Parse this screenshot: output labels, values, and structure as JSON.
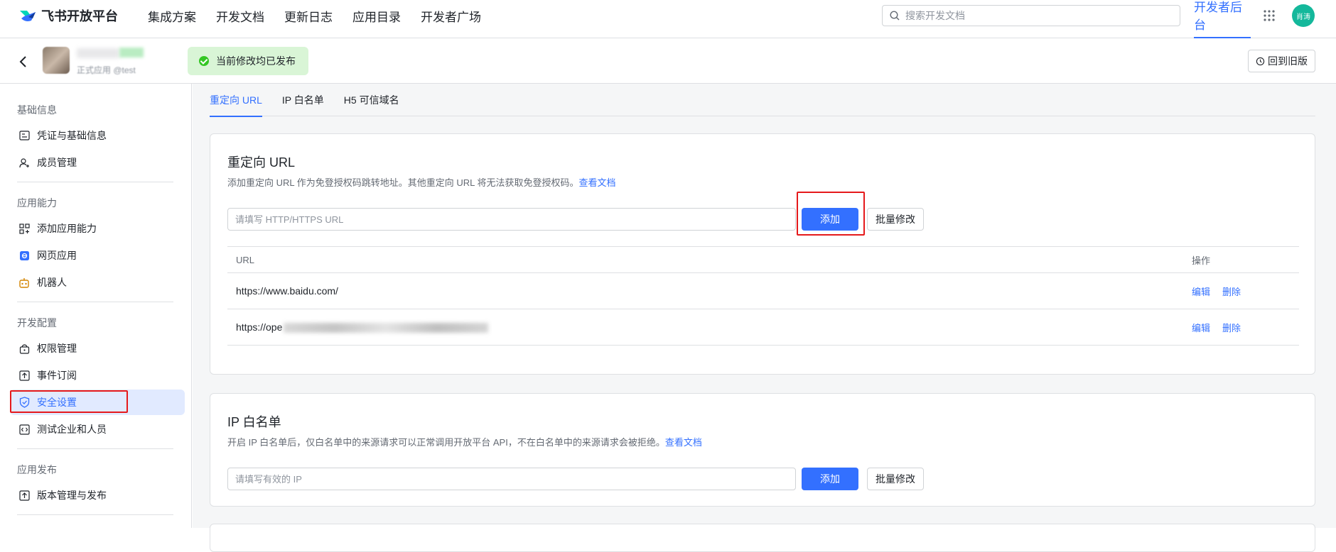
{
  "header": {
    "brand": "飞书开放平台",
    "nav": [
      "集成方案",
      "开发文档",
      "更新日志",
      "应用目录",
      "开发者广场"
    ],
    "search_placeholder": "搜索开发文档",
    "console_label": "开发者后台",
    "user_avatar_text": "肖涛",
    "accent_color": "#3370ff"
  },
  "app_bar": {
    "app_subtitle": "正式应用 @test",
    "publish_status": "当前修改均已发布",
    "revert_label": "回到旧版"
  },
  "sidebar": {
    "groups": [
      {
        "label": "基础信息",
        "items": [
          {
            "label": "凭证与基础信息",
            "icon": "credential-icon"
          },
          {
            "label": "成员管理",
            "icon": "member-icon"
          }
        ]
      },
      {
        "label": "应用能力",
        "items": [
          {
            "label": "添加应用能力",
            "icon": "add-capability-icon"
          },
          {
            "label": "网页应用",
            "icon": "web-app-icon"
          },
          {
            "label": "机器人",
            "icon": "robot-icon"
          }
        ]
      },
      {
        "label": "开发配置",
        "items": [
          {
            "label": "权限管理",
            "icon": "permission-icon"
          },
          {
            "label": "事件订阅",
            "icon": "event-icon"
          },
          {
            "label": "安全设置",
            "icon": "shield-icon",
            "active": true
          },
          {
            "label": "测试企业和人员",
            "icon": "code-icon"
          }
        ]
      },
      {
        "label": "应用发布",
        "items": [
          {
            "label": "版本管理与发布",
            "icon": "upload-icon"
          }
        ]
      }
    ]
  },
  "tabs": [
    {
      "label": "重定向 URL",
      "active": true
    },
    {
      "label": "IP 白名单"
    },
    {
      "label": "H5 可信域名"
    }
  ],
  "redirect": {
    "title": "重定向 URL",
    "desc": "添加重定向 URL 作为免登授权码跳转地址。其他重定向 URL 将无法获取免登授权码。",
    "doc_link": "查看文档",
    "placeholder": "请填写 HTTP/HTTPS URL",
    "add_label": "添加",
    "batch_label": "批量修改",
    "col_url": "URL",
    "col_op": "操作",
    "rows": [
      {
        "url": "https://www.baidu.com/",
        "edit": "编辑",
        "delete": "删除"
      },
      {
        "url": "https://ope",
        "edit": "编辑",
        "delete": "删除"
      }
    ]
  },
  "ip_whitelist": {
    "title": "IP 白名单",
    "desc": "开启 IP 白名单后，仅白名单中的来源请求可以正常调用开放平台 API，不在白名单中的来源请求会被拒绝。",
    "doc_link": "查看文档",
    "placeholder": "请填写有效的 IP",
    "add_label": "添加",
    "batch_label": "批量修改"
  }
}
